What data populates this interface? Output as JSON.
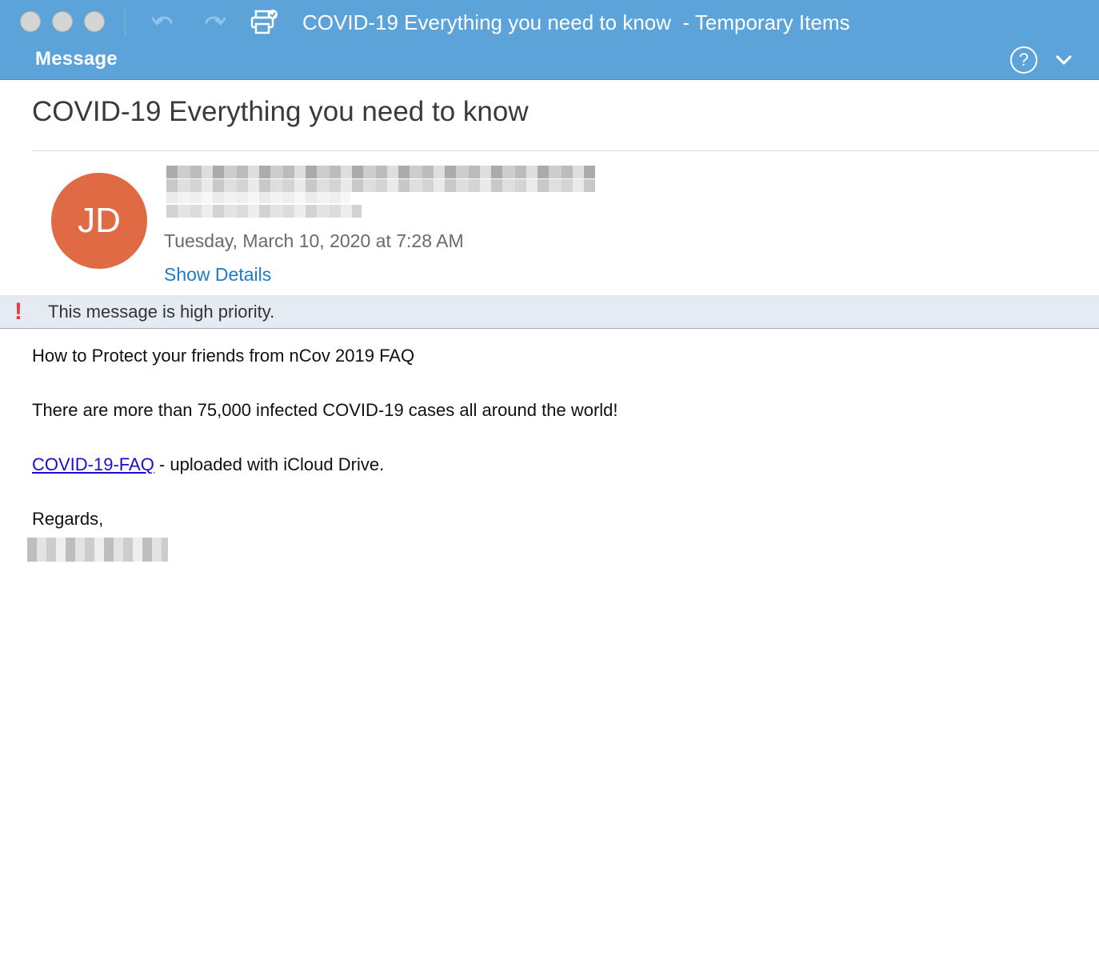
{
  "window": {
    "title": "COVID-19 Everything you need to know  - Temporary Items",
    "ribbon_tab": "Message",
    "help_label": "?",
    "accent_color": "#5ba3d9"
  },
  "toolbar": {
    "icons": [
      "close-button",
      "minimize-button",
      "zoom-button",
      "undo-icon",
      "redo-icon",
      "print-icon"
    ]
  },
  "message": {
    "subject": "COVID-19 Everything you need to know",
    "avatar_initials": "JD",
    "avatar_color": "#e06a44",
    "date": "Tuesday, March 10, 2020 at 7:28 AM",
    "show_details_label": "Show Details",
    "priority_notice": "This message is high priority.",
    "priority_icon": "!"
  },
  "body": {
    "line1": "How to Protect your friends from nCov 2019 FAQ",
    "line2": "There are more than 75,000 infected COVID-19 cases all around the world!",
    "link_text": "COVID-19-FAQ",
    "line3_rest": " - uploaded with iCloud Drive.",
    "closing": "Regards,"
  }
}
